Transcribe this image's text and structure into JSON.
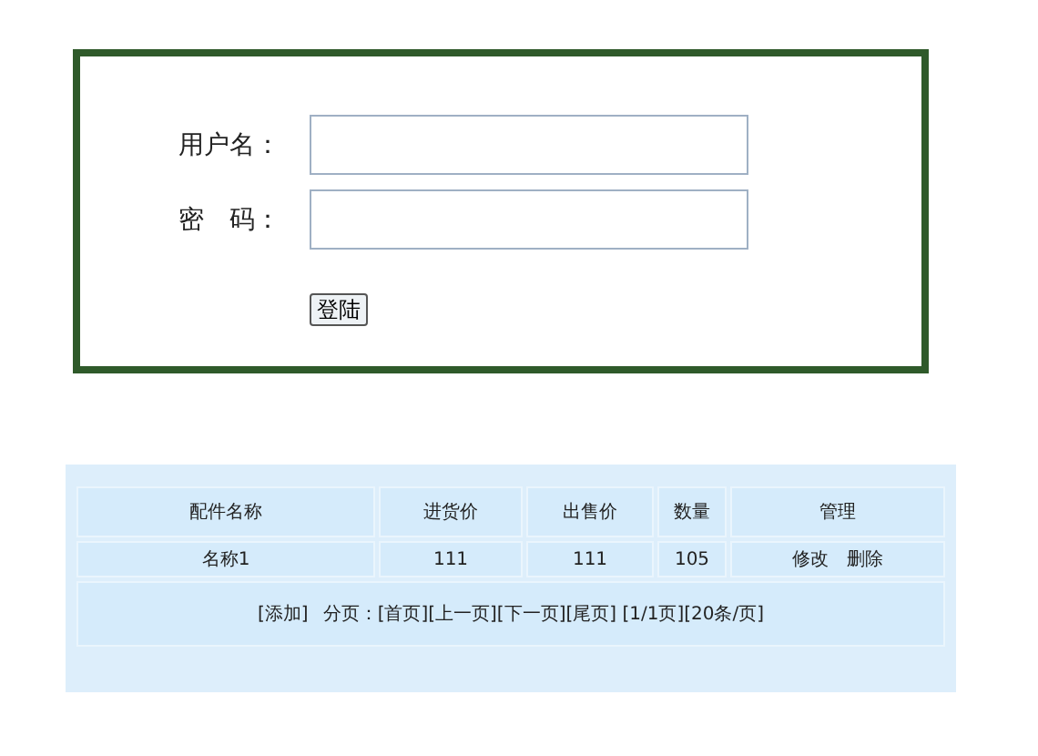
{
  "login": {
    "fields": [
      {
        "label": "用户名："
      },
      {
        "label": "密　码："
      }
    ],
    "button": "登陆"
  },
  "table": {
    "columns": [
      "配件名称",
      "进货价",
      "出售价",
      "数量",
      "管理"
    ],
    "rows": [
      {
        "cells": [
          "名称1",
          "111",
          "111",
          "105"
        ],
        "actions": [
          "修改",
          "删除"
        ]
      }
    ],
    "footer": [
      "[添加]",
      "分页：[首页][上一页][下一页][尾页] [1/1页][20条/页]"
    ]
  }
}
